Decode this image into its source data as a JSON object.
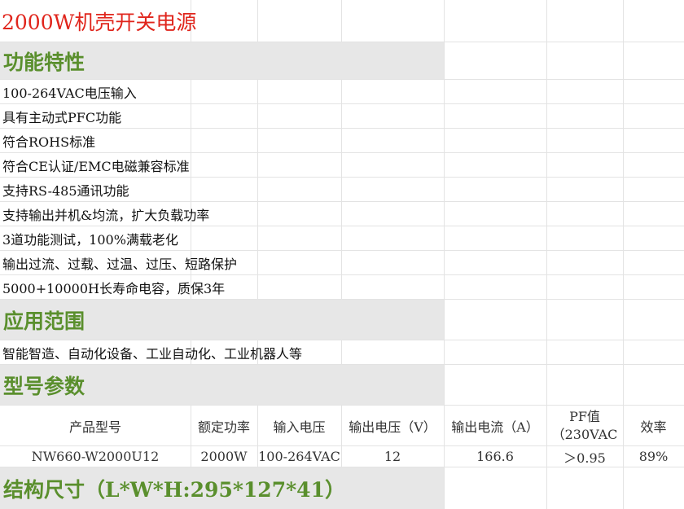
{
  "title": "2000W机壳开关电源",
  "sections": {
    "features": "功能特性",
    "application": "应用范围",
    "model_params": "型号参数",
    "structure": "结构尺寸（L*W*H:295*127*41）"
  },
  "features": [
    "100-264VAC电压输入",
    "具有主动式PFC功能",
    "符合ROHS标准",
    "符合CE认证/EMC电磁兼容标准",
    "支持RS-485通讯功能",
    "支持输出并机&均流，扩大负载功率",
    "3道功能测试，100%满载老化",
    "输出过流、过载、过温、过压、短路保护",
    "5000+10000H长寿命电容，质保3年"
  ],
  "application_text": "智能智造、自动化设备、工业自动化、工业机器人等",
  "table": {
    "headers": {
      "model": "产品型号",
      "rated_power": "额定功率",
      "input_voltage": "输入电压",
      "output_voltage": "输出电压（V）",
      "output_current": "输出电流（A）",
      "pf_line1": "PF值",
      "pf_line2": "（230VAC",
      "efficiency": "效率"
    },
    "row": {
      "model": "NW660-W2000U12",
      "rated_power": "2000W",
      "input_voltage": "100-264VAC",
      "output_voltage": "12",
      "output_current": "166.6",
      "pf": "＞0.95",
      "efficiency": "89%"
    }
  }
}
